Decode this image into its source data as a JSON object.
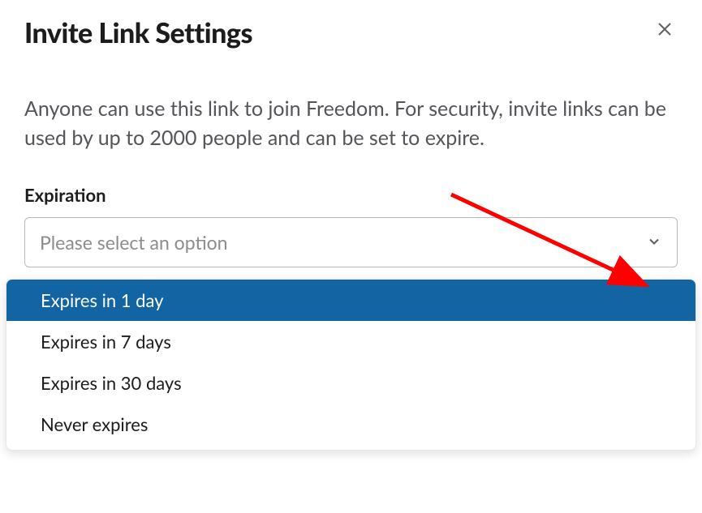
{
  "dialog": {
    "title": "Invite Link Settings",
    "description": "Anyone can use this link to join Freedom. For security, invite links can be used by up to 2000 people and can be set to expire."
  },
  "expiration": {
    "label": "Expiration",
    "placeholder": "Please select an option",
    "options": [
      "Expires in 1 day",
      "Expires in 7 days",
      "Expires in 30 days",
      "Never expires"
    ],
    "highlighted_index": 0
  },
  "colors": {
    "highlight": "#1264a3",
    "arrow": "#fe0000"
  }
}
